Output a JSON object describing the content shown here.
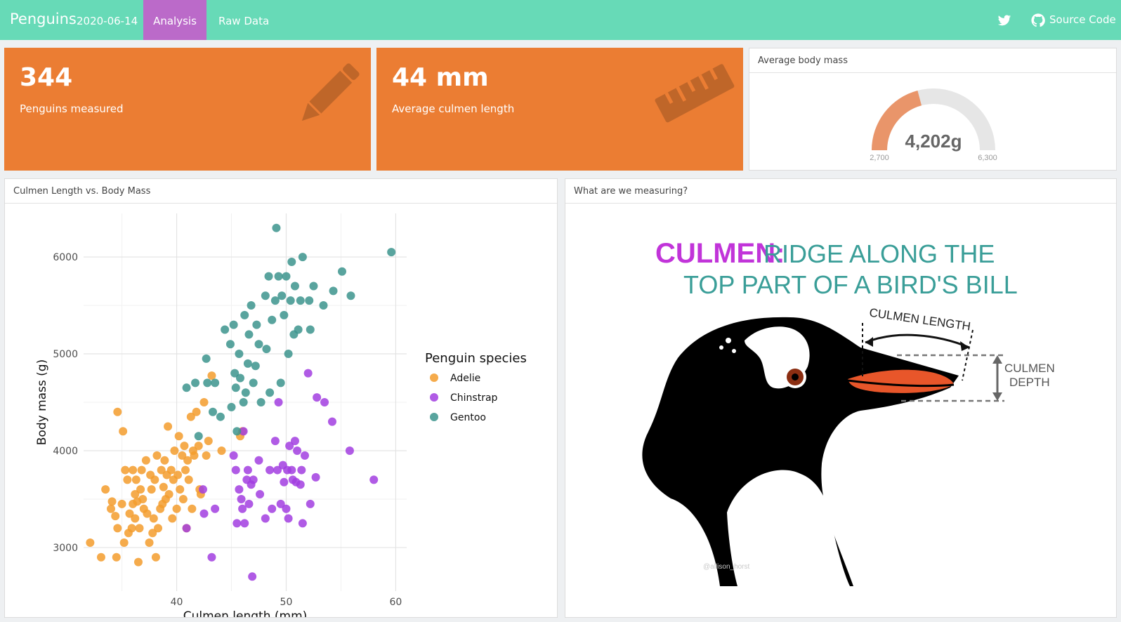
{
  "nav": {
    "brand": "Penguins",
    "date": "2020-06-14",
    "tabs": [
      {
        "label": "Analysis",
        "active": true
      },
      {
        "label": "Raw Data",
        "active": false
      }
    ],
    "twitter_icon": "twitter-icon",
    "github_icon": "github-icon",
    "source_code": "Source Code",
    "color": "#67dab7",
    "active_color": "#bb6ac9"
  },
  "value_boxes": [
    {
      "value": "344",
      "caption": "Penguins measured",
      "icon": "pencil-icon",
      "color": "#eb7d33"
    },
    {
      "value": "44 mm",
      "caption": "Average culmen length",
      "icon": "ruler-icon",
      "color": "#eb7d33"
    }
  ],
  "gauge": {
    "title": "Average body mass",
    "value_label": "4,202g",
    "value": 4202,
    "min": 2700,
    "max": 6300,
    "min_label": "2,700",
    "max_label": "6,300",
    "fill_color": "#e9956a",
    "track_color": "#e6e6e6"
  },
  "scatter_card": {
    "title": "Culmen Length vs. Body Mass"
  },
  "illustration_card": {
    "title": "What are we measuring?",
    "heading_word": "CULMEN:",
    "heading_rest_1": "RIDGE ALONG THE",
    "heading_rest_2": "TOP PART OF A BIRD'S BILL",
    "label_length": "CULMEN LENGTH",
    "label_depth_1": "CULMEN",
    "label_depth_2": "DEPTH",
    "credit": "@allison_horst"
  },
  "chart_data": {
    "type": "scatter",
    "title": "",
    "xlabel": "Culmen length (mm)",
    "ylabel": "Body mass (g)",
    "xlim": [
      31.5,
      61
    ],
    "ylim": [
      2550,
      6450
    ],
    "x_ticks": [
      40,
      50,
      60
    ],
    "y_ticks": [
      3000,
      4000,
      5000,
      6000
    ],
    "grid": true,
    "legend_title": "Penguin species",
    "legend_position": "right",
    "series": [
      {
        "name": "Adelie",
        "color": "#f39c2d",
        "points": [
          [
            32.1,
            3050
          ],
          [
            33.1,
            2900
          ],
          [
            33.5,
            3600
          ],
          [
            34.0,
            3400
          ],
          [
            34.1,
            3475
          ],
          [
            34.4,
            3325
          ],
          [
            34.5,
            2900
          ],
          [
            34.6,
            3200
          ],
          [
            34.6,
            4400
          ],
          [
            35.0,
            3450
          ],
          [
            35.1,
            4200
          ],
          [
            35.2,
            3050
          ],
          [
            35.3,
            3800
          ],
          [
            35.5,
            3700
          ],
          [
            35.6,
            3150
          ],
          [
            35.7,
            3350
          ],
          [
            35.9,
            3200
          ],
          [
            36.0,
            3450
          ],
          [
            36.0,
            3800
          ],
          [
            36.2,
            3300
          ],
          [
            36.2,
            3550
          ],
          [
            36.3,
            3700
          ],
          [
            36.4,
            3475
          ],
          [
            36.5,
            2850
          ],
          [
            36.6,
            3200
          ],
          [
            36.7,
            3600
          ],
          [
            36.8,
            3800
          ],
          [
            36.9,
            3500
          ],
          [
            37.0,
            3400
          ],
          [
            37.2,
            3900
          ],
          [
            37.3,
            3350
          ],
          [
            37.5,
            3050
          ],
          [
            37.6,
            3750
          ],
          [
            37.7,
            3600
          ],
          [
            37.8,
            3150
          ],
          [
            37.9,
            3300
          ],
          [
            38.0,
            3700
          ],
          [
            38.1,
            2900
          ],
          [
            38.2,
            3950
          ],
          [
            38.3,
            3200
          ],
          [
            38.5,
            3400
          ],
          [
            38.6,
            3800
          ],
          [
            38.7,
            3450
          ],
          [
            38.8,
            3625
          ],
          [
            38.9,
            3900
          ],
          [
            39.0,
            3500
          ],
          [
            39.1,
            3750
          ],
          [
            39.2,
            4250
          ],
          [
            39.3,
            3550
          ],
          [
            39.5,
            3800
          ],
          [
            39.6,
            3300
          ],
          [
            39.7,
            3700
          ],
          [
            39.8,
            4000
          ],
          [
            40.0,
            3400
          ],
          [
            40.1,
            3750
          ],
          [
            40.2,
            4150
          ],
          [
            40.3,
            3600
          ],
          [
            40.5,
            3950
          ],
          [
            40.6,
            3500
          ],
          [
            40.7,
            4050
          ],
          [
            40.8,
            3800
          ],
          [
            40.9,
            3200
          ],
          [
            41.0,
            3900
          ],
          [
            41.1,
            3700
          ],
          [
            41.3,
            4350
          ],
          [
            41.4,
            3400
          ],
          [
            41.5,
            4000
          ],
          [
            41.6,
            3950
          ],
          [
            41.8,
            4400
          ],
          [
            42.0,
            4050
          ],
          [
            42.1,
            3600
          ],
          [
            42.2,
            3550
          ],
          [
            42.5,
            4500
          ],
          [
            42.7,
            3950
          ],
          [
            42.9,
            4100
          ],
          [
            43.2,
            4775
          ],
          [
            44.1,
            4000
          ],
          [
            45.8,
            4150
          ],
          [
            46.0,
            4200
          ]
        ]
      },
      {
        "name": "Chinstrap",
        "color": "#a23ee0",
        "points": [
          [
            40.9,
            3200
          ],
          [
            42.4,
            3600
          ],
          [
            42.5,
            3350
          ],
          [
            43.2,
            2900
          ],
          [
            43.5,
            3400
          ],
          [
            45.2,
            3950
          ],
          [
            45.4,
            3800
          ],
          [
            45.5,
            3250
          ],
          [
            45.7,
            3600
          ],
          [
            45.9,
            3500
          ],
          [
            46.0,
            3400
          ],
          [
            46.1,
            4200
          ],
          [
            46.2,
            3250
          ],
          [
            46.4,
            3700
          ],
          [
            46.5,
            3800
          ],
          [
            46.6,
            3450
          ],
          [
            46.8,
            3650
          ],
          [
            46.9,
            2700
          ],
          [
            47.0,
            3700
          ],
          [
            47.5,
            3900
          ],
          [
            47.6,
            3550
          ],
          [
            48.1,
            3300
          ],
          [
            48.5,
            3800
          ],
          [
            48.7,
            3400
          ],
          [
            49.0,
            4100
          ],
          [
            49.2,
            3800
          ],
          [
            49.3,
            4500
          ],
          [
            49.5,
            3450
          ],
          [
            49.7,
            3850
          ],
          [
            49.8,
            3675
          ],
          [
            50.0,
            3400
          ],
          [
            50.1,
            3800
          ],
          [
            50.2,
            3300
          ],
          [
            50.3,
            4050
          ],
          [
            50.5,
            3800
          ],
          [
            50.6,
            3700
          ],
          [
            50.8,
            4100
          ],
          [
            50.9,
            3675
          ],
          [
            51.0,
            4000
          ],
          [
            51.3,
            3650
          ],
          [
            51.4,
            3800
          ],
          [
            51.5,
            3250
          ],
          [
            51.7,
            3950
          ],
          [
            52.0,
            4800
          ],
          [
            52.2,
            3450
          ],
          [
            52.7,
            3725
          ],
          [
            52.8,
            4550
          ],
          [
            53.5,
            4500
          ],
          [
            54.2,
            4300
          ],
          [
            55.8,
            4000
          ],
          [
            58.0,
            3700
          ]
        ]
      },
      {
        "name": "Gentoo",
        "color": "#3c948d",
        "points": [
          [
            40.9,
            4650
          ],
          [
            41.7,
            4700
          ],
          [
            42.0,
            4150
          ],
          [
            42.7,
            4950
          ],
          [
            42.8,
            4700
          ],
          [
            43.3,
            4400
          ],
          [
            43.5,
            4700
          ],
          [
            44.0,
            4350
          ],
          [
            44.4,
            5250
          ],
          [
            44.9,
            5100
          ],
          [
            45.0,
            4450
          ],
          [
            45.2,
            5300
          ],
          [
            45.3,
            4800
          ],
          [
            45.4,
            4650
          ],
          [
            45.5,
            4200
          ],
          [
            45.7,
            5000
          ],
          [
            45.8,
            4750
          ],
          [
            46.1,
            4500
          ],
          [
            46.2,
            5400
          ],
          [
            46.3,
            4600
          ],
          [
            46.5,
            4900
          ],
          [
            46.6,
            5200
          ],
          [
            46.8,
            5500
          ],
          [
            47.0,
            4700
          ],
          [
            47.2,
            4875
          ],
          [
            47.3,
            5300
          ],
          [
            47.5,
            5100
          ],
          [
            47.7,
            4500
          ],
          [
            48.1,
            5600
          ],
          [
            48.2,
            5050
          ],
          [
            48.4,
            5800
          ],
          [
            48.5,
            4600
          ],
          [
            48.7,
            5350
          ],
          [
            49.0,
            5550
          ],
          [
            49.1,
            6300
          ],
          [
            49.3,
            5800
          ],
          [
            49.5,
            4700
          ],
          [
            49.6,
            5600
          ],
          [
            49.8,
            5400
          ],
          [
            50.0,
            5800
          ],
          [
            50.2,
            5000
          ],
          [
            50.4,
            5550
          ],
          [
            50.5,
            5950
          ],
          [
            50.7,
            5200
          ],
          [
            50.8,
            5700
          ],
          [
            51.1,
            5250
          ],
          [
            51.3,
            5550
          ],
          [
            51.5,
            6000
          ],
          [
            52.1,
            5550
          ],
          [
            52.2,
            5250
          ],
          [
            52.5,
            5700
          ],
          [
            53.4,
            5500
          ],
          [
            54.3,
            5650
          ],
          [
            55.1,
            5850
          ],
          [
            55.9,
            5600
          ],
          [
            59.6,
            6050
          ]
        ]
      }
    ]
  }
}
